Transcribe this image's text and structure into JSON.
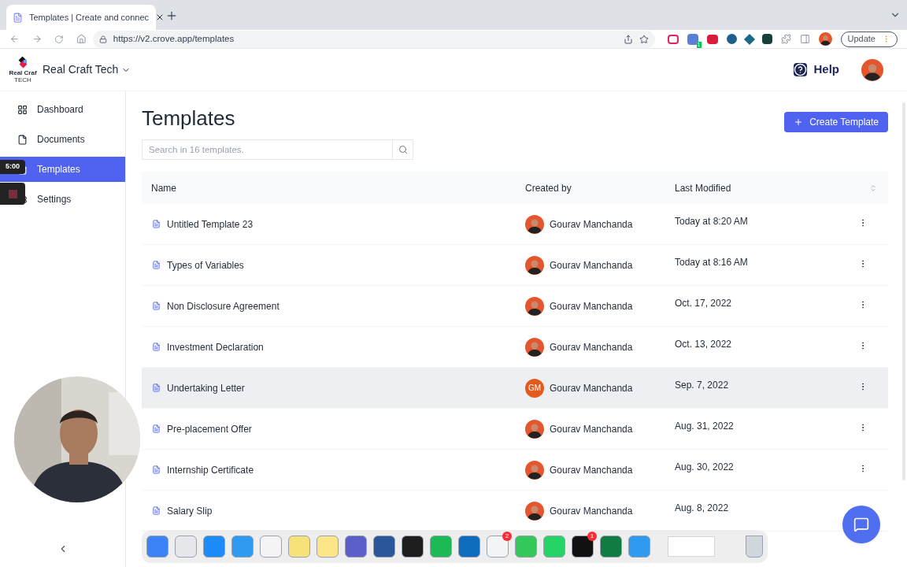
{
  "browser": {
    "tab_title": "Templates | Create and connec",
    "url": "https://v2.crove.app/templates",
    "update_button": "Update",
    "extension_badge": "1"
  },
  "header": {
    "logo_text": "Real Craf",
    "logo_subtext": "TECH",
    "org_name": "Real Craft Tech",
    "help": "Help"
  },
  "sidebar": {
    "items": [
      {
        "label": "Dashboard",
        "selected": false
      },
      {
        "label": "Documents",
        "selected": false
      },
      {
        "label": "Templates",
        "selected": true
      },
      {
        "label": "Settings",
        "selected": false
      }
    ]
  },
  "recording": {
    "timer": "5:00"
  },
  "page": {
    "title": "Templates",
    "create_button": "Create Template",
    "search": {
      "placeholder": "Search in 16 templates."
    }
  },
  "table": {
    "columns": [
      "Name",
      "Created by",
      "Last Modified"
    ],
    "rows": [
      {
        "name": "Untitled Template 23",
        "author": "Gourav Manchanda",
        "modified": "Today at 8:20 AM",
        "highlighted": false
      },
      {
        "name": "Types of Variables",
        "author": "Gourav Manchanda",
        "modified": "Today at 8:16 AM",
        "highlighted": false
      },
      {
        "name": "Non Disclosure Agreement",
        "author": "Gourav Manchanda",
        "modified": "Oct. 17, 2022",
        "highlighted": false
      },
      {
        "name": "Investment Declaration",
        "author": "Gourav Manchanda",
        "modified": "Oct. 13, 2022",
        "highlighted": false
      },
      {
        "name": "Undertaking Letter",
        "author": "Gourav Manchanda",
        "initials": "GM",
        "modified": "Sep. 7, 2022",
        "highlighted": true
      },
      {
        "name": "Pre-placement Offer",
        "author": "Gourav Manchanda",
        "modified": "Aug. 31, 2022",
        "highlighted": false
      },
      {
        "name": "Internship Certificate",
        "author": "Gourav Manchanda",
        "modified": "Aug. 30, 2022",
        "highlighted": false
      },
      {
        "name": "Salary Slip",
        "author": "Gourav Manchanda",
        "modified": "Aug. 8, 2022",
        "highlighted": false
      }
    ]
  },
  "dock": {
    "apps": [
      {
        "color": "#3b82f6"
      },
      {
        "color": "#e5e7eb"
      },
      {
        "color": "#1d8cf8"
      },
      {
        "color": "#2f9bf0"
      },
      {
        "color": "#f4f4f4"
      },
      {
        "color": "#f7e27a"
      },
      {
        "color": "#fde68a"
      },
      {
        "color": "#5b5fc7"
      },
      {
        "color": "#2b579a"
      },
      {
        "color": "#1e1e1e"
      },
      {
        "color": "#1db954"
      },
      {
        "color": "#0f6cbd"
      },
      {
        "color": "#f3f4f6",
        "badge": "2"
      },
      {
        "color": "#34c759"
      },
      {
        "color": "#25d366"
      },
      {
        "color": "#111111",
        "badge": "1"
      },
      {
        "color": "#107c41"
      },
      {
        "color": "#2f9bf0"
      }
    ]
  }
}
